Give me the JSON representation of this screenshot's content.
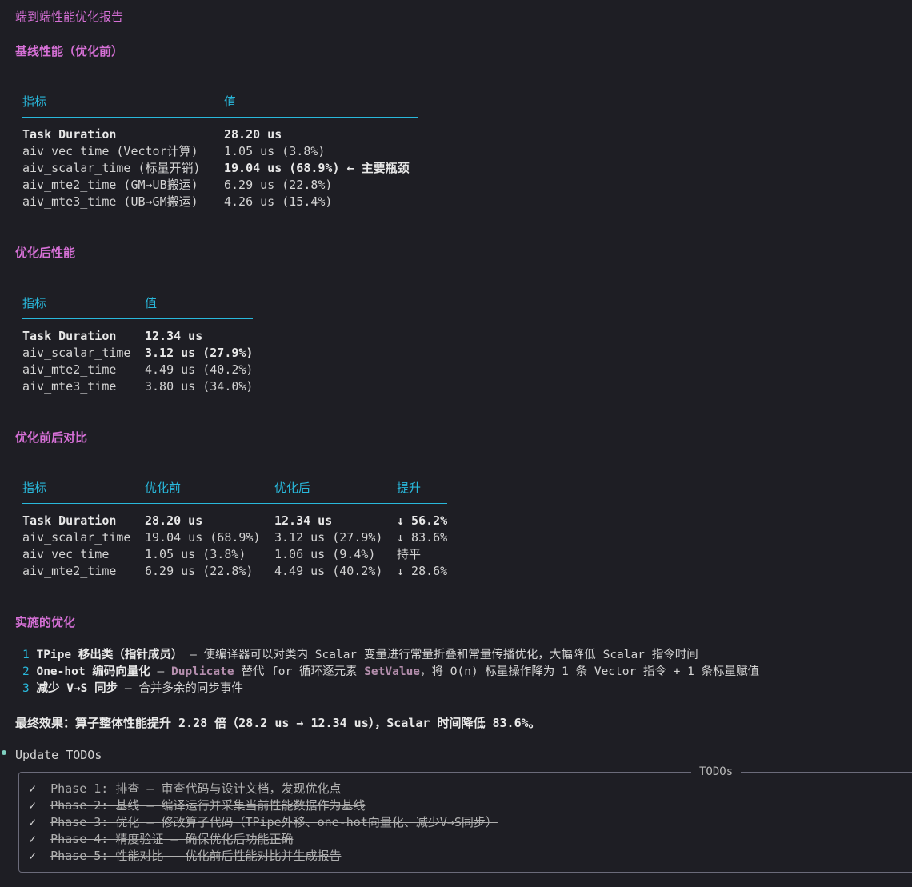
{
  "title": "端到端性能优化报告",
  "baseline": {
    "heading": "基线性能（优化前）",
    "headers": [
      "指标",
      "值"
    ],
    "rows": [
      [
        "Task Duration",
        "28.20 us"
      ],
      [
        "aiv_vec_time (Vector计算)",
        "1.05 us (3.8%)"
      ],
      [
        "aiv_scalar_time (标量开销)",
        "19.04 us (68.9%) ← 主要瓶颈"
      ],
      [
        "aiv_mte2_time (GM→UB搬运)",
        "6.29 us (22.8%)"
      ],
      [
        "aiv_mte3_time (UB→GM搬运)",
        "4.26 us (15.4%)"
      ]
    ]
  },
  "after": {
    "heading": "优化后性能",
    "headers": [
      "指标",
      "值"
    ],
    "rows": [
      [
        "Task Duration",
        "12.34 us"
      ],
      [
        "aiv_scalar_time",
        "3.12 us (27.9%)"
      ],
      [
        "aiv_mte2_time",
        "4.49 us (40.2%)"
      ],
      [
        "aiv_mte3_time",
        "3.80 us (34.0%)"
      ]
    ]
  },
  "compare": {
    "heading": "优化前后对比",
    "headers": [
      "指标",
      "优化前",
      "优化后",
      "提升"
    ],
    "rows": [
      [
        "Task Duration",
        "28.20 us",
        "12.34 us",
        "↓ 56.2%"
      ],
      [
        "aiv_scalar_time",
        "19.04 us (68.9%)",
        "3.12 us (27.9%)",
        "↓ 83.6%"
      ],
      [
        "aiv_vec_time",
        "1.05 us (3.8%)",
        "1.06 us (9.4%)",
        "持平"
      ],
      [
        "aiv_mte2_time",
        "6.29 us (22.8%)",
        "4.49 us (40.2%)",
        "↓ 28.6%"
      ]
    ]
  },
  "optimizations": {
    "heading": "实施的优化",
    "items": [
      {
        "num": "1",
        "bold": "TPipe 移出类（指针成员）",
        "rest": " — 使编译器可以对类内 Scalar 变量进行常量折叠和常量传播优化，大幅降低 Scalar 指令时间"
      },
      {
        "num": "2",
        "bold": "One-hot 编码向量化",
        "mid1": " — ",
        "kw1": "Duplicate",
        "mid2": " 替代 for 循环逐元素 ",
        "kw2": "SetValue",
        "rest": "，将 O(n) 标量操作降为 1 条 Vector 指令 + 1 条标量赋值"
      },
      {
        "num": "3",
        "bold": "减少 V→S 同步",
        "rest": " — 合并多余的同步事件"
      }
    ]
  },
  "final": "最终效果：算子整体性能提升 2.28 倍（28.2 us → 12.34 us），Scalar 时间降低 83.6%。",
  "update_todos": "Update TODOs",
  "todos": {
    "label": "TODOs",
    "items": [
      {
        "check": "✓",
        "text": "Phase 1: 排查 — 审查代码与设计文档，发现优化点"
      },
      {
        "check": "✓",
        "text": "Phase 2: 基线 — 编译运行并采集当前性能数据作为基线"
      },
      {
        "check": "✓",
        "text": "Phase 3: 优化 — 修改算子代码（TPipe外移、one-hot向量化、减少V→S同步）"
      },
      {
        "check": "✓",
        "text": "Phase 4: 精度验证 — 确保优化后功能正确"
      },
      {
        "check": "✓",
        "text": "Phase 5: 性能对比 — 优化前后性能对比并生成报告"
      }
    ]
  }
}
